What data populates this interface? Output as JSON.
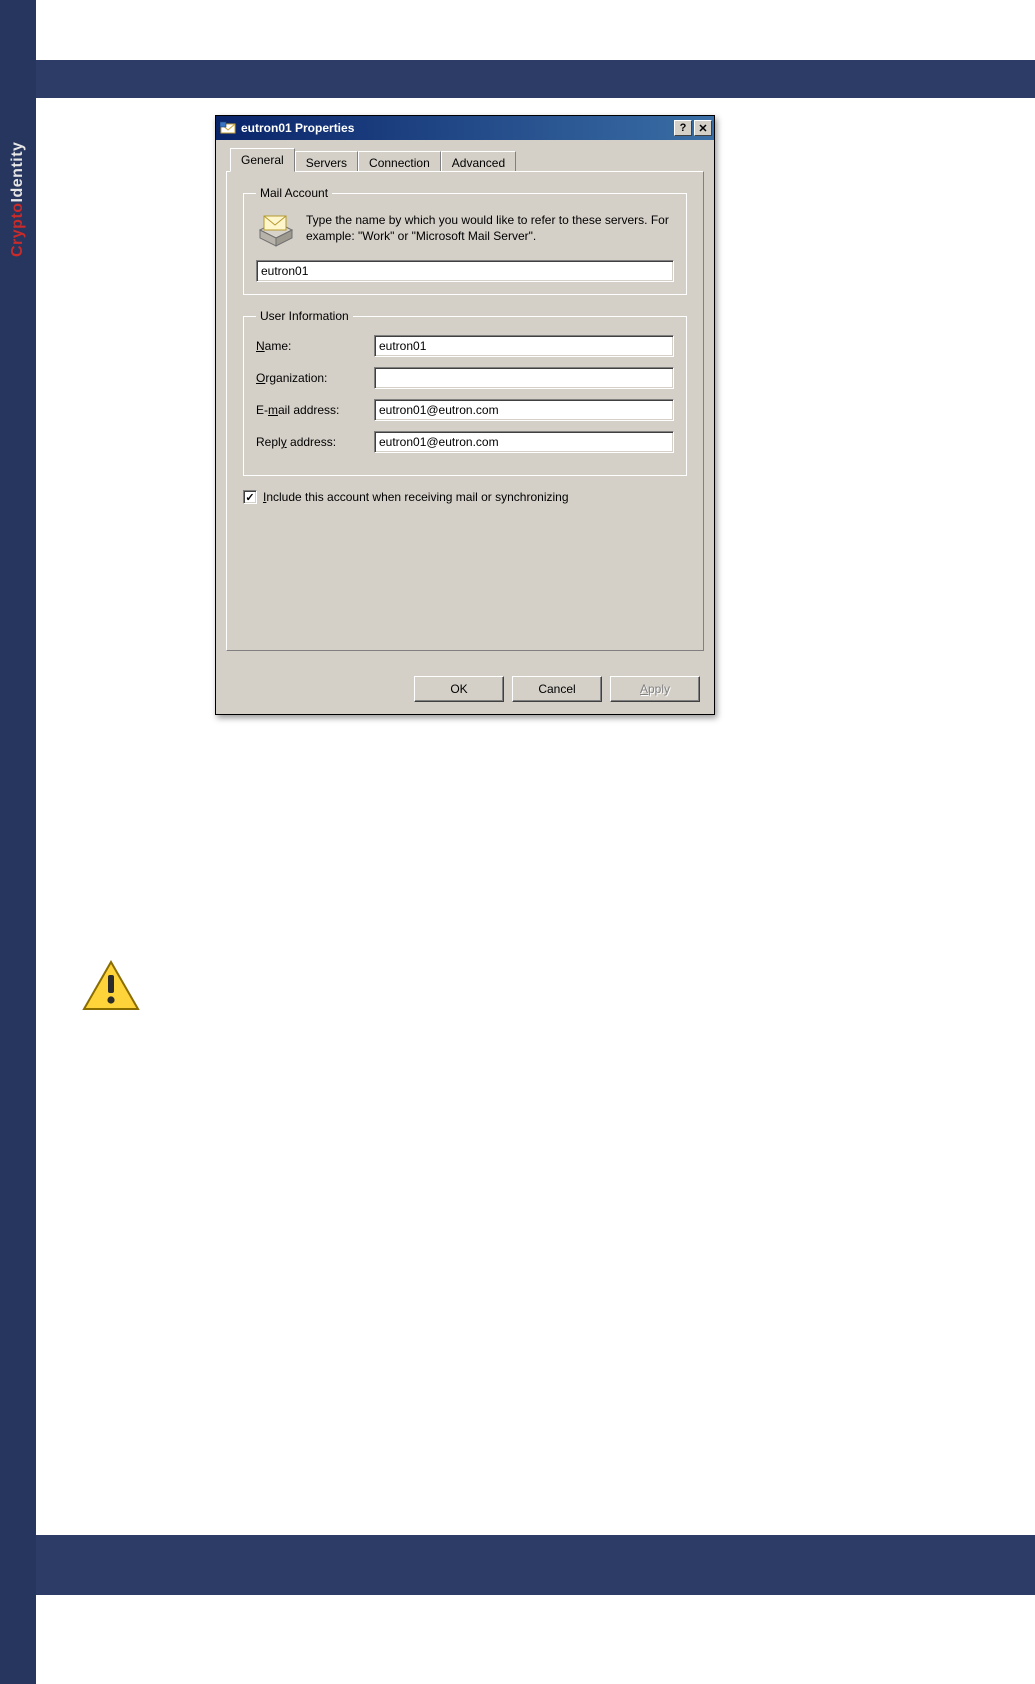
{
  "brand": {
    "part1": "Crypto",
    "part2": "Identity"
  },
  "dialog": {
    "title": "eutron01 Properties",
    "tabs": [
      "General",
      "Servers",
      "Connection",
      "Advanced"
    ],
    "active_tab_index": 0,
    "mail_account": {
      "legend": "Mail Account",
      "description": "Type the name by which you would like to refer to these servers.  For example: \"Work\" or \"Microsoft Mail Server\".",
      "value": "eutron01"
    },
    "user_info": {
      "legend": "User Information",
      "name_label": "Name:",
      "name_value": "eutron01",
      "org_label": "Organization:",
      "org_value": "",
      "email_label": "E-mail address:",
      "email_value": "eutron01@eutron.com",
      "reply_label": "Reply address:",
      "reply_value": "eutron01@eutron.com"
    },
    "include_checkbox": {
      "label": "Include this account when receiving mail or synchronizing",
      "checked": true
    },
    "buttons": {
      "ok": "OK",
      "cancel": "Cancel",
      "apply": "Apply"
    },
    "titlebar_buttons": {
      "help": "?",
      "close": "✕"
    }
  }
}
